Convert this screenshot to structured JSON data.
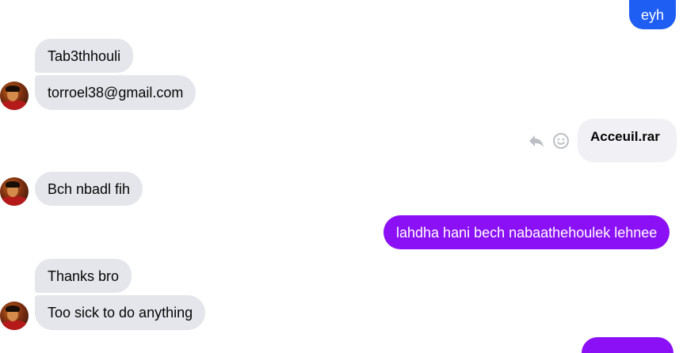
{
  "colors": {
    "incoming_bubble": "#e4e6eb",
    "outgoing_blue": "#1e5ef3",
    "outgoing_purple": "#8b10f5",
    "file_bubble": "#f0f0f5",
    "action_icon": "#bcc0c4"
  },
  "messages": [
    {
      "sender": "me",
      "text": "eyh"
    },
    {
      "sender": "contact",
      "text": "Tab3thhouli"
    },
    {
      "sender": "contact",
      "text": "torroel38@gmail.com"
    },
    {
      "sender": "me",
      "type": "file",
      "text": "Acceuil.rar"
    },
    {
      "sender": "contact",
      "text": "Bch nbadl fih"
    },
    {
      "sender": "me",
      "text": "lahdha hani bech nabaathehoulek lehnee"
    },
    {
      "sender": "contact",
      "text": "Thanks bro"
    },
    {
      "sender": "contact",
      "text": "Too sick to do anything"
    }
  ],
  "actions": {
    "reply_icon": "reply-arrow-icon",
    "react_icon": "smiley-icon"
  }
}
